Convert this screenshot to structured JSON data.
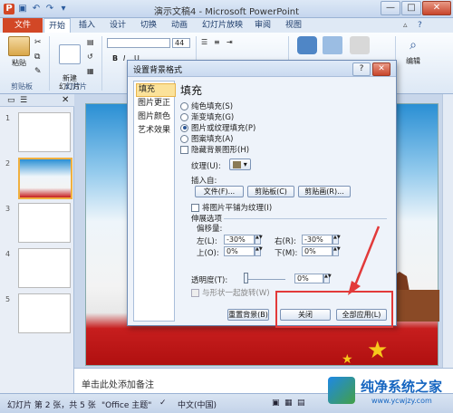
{
  "window": {
    "title": "演示文稿4 - Microsoft PowerPoint",
    "controls": [
      "—",
      "□",
      "✕"
    ]
  },
  "ribbon": {
    "tabs": [
      "文件",
      "开始",
      "插入",
      "设计",
      "切换",
      "动画",
      "幻灯片放映",
      "审阅",
      "视图"
    ],
    "paste_label": "粘贴",
    "new_slide_label": "新建\n幻灯片",
    "clipboard_group": "剪贴板",
    "slides_group": "幻灯片",
    "font_size": "44",
    "edit_label": "编辑"
  },
  "slides_pane": {
    "thumb_numbers": [
      "1",
      "2",
      "3",
      "4",
      "5"
    ],
    "selected_index": 2
  },
  "notes": {
    "placeholder": "单击此处添加备注"
  },
  "status": {
    "slide_info": "幻灯片 第 2 张，共 5 张",
    "theme": "\"Office 主题\"",
    "language": "中文(中国)",
    "zoom": "..."
  },
  "dialog": {
    "title": "设置背景格式",
    "help_btn": "?",
    "close_btn": "✕",
    "side_items": [
      "填充",
      "图片更正",
      "图片颜色",
      "艺术效果"
    ],
    "section_title": "填充",
    "fill_options": [
      "纯色填充(S)",
      "渐变填充(G)",
      "图片或纹理填充(P)",
      "图案填充(A)"
    ],
    "selected_fill": 2,
    "hide_bg_graphics": "隐藏背景图形(H)",
    "texture_label": "纹理(U):",
    "insert_from": "插入自:",
    "file_btn": "文件(F)...",
    "clipboard_btn": "剪贴板(C)",
    "clipart_btn": "剪贴画(R)...",
    "tile_label": "将图片平铺为纹理(I)",
    "stretch_label": "伸展选项",
    "offset_label": "偏移量:",
    "left_label": "左(L):",
    "left_val": "-30%",
    "right_label": "右(R):",
    "right_val": "-30%",
    "top_label": "上(O):",
    "top_val": "0%",
    "bottom_label": "下(M):",
    "bottom_val": "0%",
    "transparency_label": "透明度(T):",
    "transparency_val": "0%",
    "transparency_level": 0,
    "rotate_label": "与形状一起旋转(W)",
    "reset_btn": "重置背景(B)",
    "close_button": "关闭",
    "apply_all_btn": "全部应用(L)"
  },
  "watermark": {
    "title": "纯净系统之家",
    "url": "www.ycwjzy.com"
  },
  "colors": {
    "file_tab": "#d24726",
    "highlight_box": "#e23a3a",
    "selected_side": "#fbe29a"
  }
}
